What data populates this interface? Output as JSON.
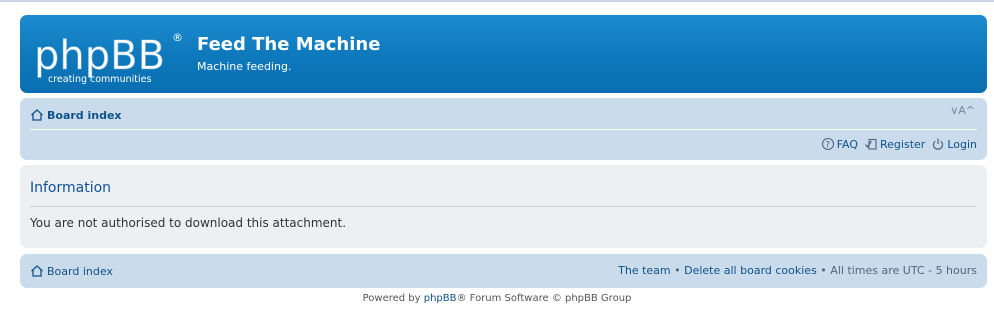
{
  "header": {
    "logo_main": "phpBB",
    "logo_reg": "®",
    "logo_tagline": "creating communities",
    "site_title": "Feed The Machine",
    "site_desc": "Machine feeding."
  },
  "nav_top": {
    "breadcrumb": "Board index",
    "font_resize": "∨A^",
    "links": [
      {
        "label": "FAQ",
        "icon": "help-icon"
      },
      {
        "label": "Register",
        "icon": "register-icon"
      },
      {
        "label": "Login",
        "icon": "power-icon"
      }
    ]
  },
  "panel": {
    "title": "Information",
    "message": "You are not authorised to download this attachment."
  },
  "nav_bottom": {
    "breadcrumb": "Board index",
    "team": "The team",
    "sep1": " • ",
    "delete_cookies": "Delete all board cookies",
    "sep2": " • ",
    "times": "All times are UTC - 5 hours"
  },
  "footer": {
    "powered_prefix": "Powered by ",
    "powered_link": "phpBB",
    "powered_suffix": "® Forum Software © phpBB Group"
  },
  "colors": {
    "header_blue": "#0d78bb",
    "nav_bg": "#cadceb",
    "panel_bg": "#ecf0f3",
    "link": "#105289"
  }
}
